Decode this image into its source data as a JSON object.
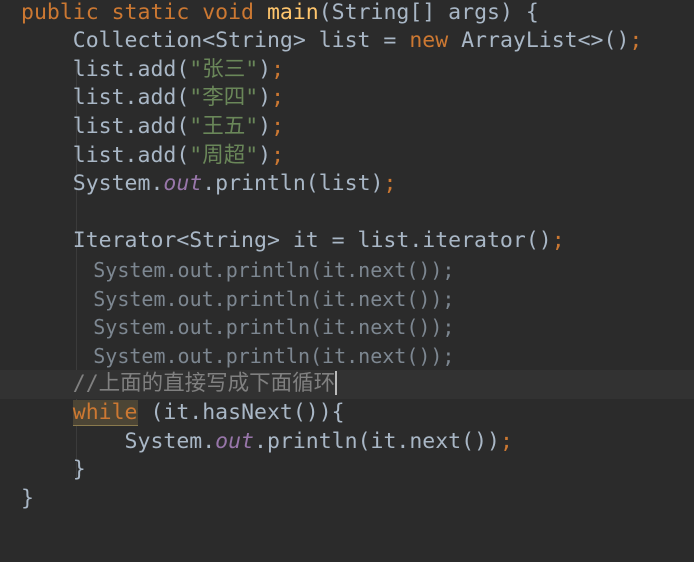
{
  "editor": {
    "lines": [
      {
        "segments": [
          {
            "t": "public static void ",
            "c": "kw"
          },
          {
            "t": "main",
            "c": "fn"
          },
          {
            "t": "(String[] args) {",
            "c": ""
          }
        ]
      },
      {
        "segments": [
          {
            "t": "    Collection<String> list = ",
            "c": ""
          },
          {
            "t": "new ",
            "c": "kw"
          },
          {
            "t": "ArrayList<>()",
            "c": ""
          },
          {
            "t": ";",
            "c": "kw"
          }
        ]
      },
      {
        "segments": [
          {
            "t": "    list.add(",
            "c": ""
          },
          {
            "t": "\"张三\"",
            "c": "str"
          },
          {
            "t": ")",
            "c": ""
          },
          {
            "t": ";",
            "c": "kw"
          }
        ]
      },
      {
        "segments": [
          {
            "t": "    list.add(",
            "c": ""
          },
          {
            "t": "\"李四\"",
            "c": "str"
          },
          {
            "t": ")",
            "c": ""
          },
          {
            "t": ";",
            "c": "kw"
          }
        ]
      },
      {
        "segments": [
          {
            "t": "    list.add(",
            "c": ""
          },
          {
            "t": "\"王五\"",
            "c": "str"
          },
          {
            "t": ")",
            "c": ""
          },
          {
            "t": ";",
            "c": "kw"
          }
        ]
      },
      {
        "segments": [
          {
            "t": "    list.add(",
            "c": ""
          },
          {
            "t": "\"周超\"",
            "c": "str"
          },
          {
            "t": ")",
            "c": ""
          },
          {
            "t": ";",
            "c": "kw"
          }
        ]
      },
      {
        "segments": [
          {
            "t": "    System.",
            "c": ""
          },
          {
            "t": "out",
            "c": "static-field"
          },
          {
            "t": ".println(list)",
            "c": ""
          },
          {
            "t": ";",
            "c": "kw"
          }
        ]
      },
      {
        "segments": []
      },
      {
        "segments": [
          {
            "t": "    Iterator<String> it = list.iterator()",
            "c": ""
          },
          {
            "t": ";",
            "c": "kw"
          }
        ]
      },
      {
        "style": "faded",
        "segments": [
          {
            "t": "      System.out.println(it.next());",
            "c": ""
          }
        ]
      },
      {
        "style": "faded",
        "segments": [
          {
            "t": "      System.out.println(it.next());",
            "c": ""
          }
        ]
      },
      {
        "style": "faded",
        "segments": [
          {
            "t": "      System.out.println(it.next());",
            "c": ""
          }
        ]
      },
      {
        "style": "faded",
        "segments": [
          {
            "t": "      System.out.println(it.next());",
            "c": ""
          }
        ]
      },
      {
        "style": "current",
        "caret": true,
        "segments": [
          {
            "t": "    //上面的直接写成下面循环",
            "c": "comment"
          }
        ]
      },
      {
        "segments": [
          {
            "t": "    ",
            "c": ""
          },
          {
            "t": "while",
            "c": "kw kw-hl"
          },
          {
            "t": " (it.hasNext()){",
            "c": ""
          }
        ]
      },
      {
        "segments": [
          {
            "t": "        System.",
            "c": ""
          },
          {
            "t": "out",
            "c": "static-field"
          },
          {
            "t": ".println(it.next())",
            "c": ""
          },
          {
            "t": ";",
            "c": "kw"
          }
        ]
      },
      {
        "segments": [
          {
            "t": "    }",
            "c": ""
          }
        ]
      },
      {
        "segments": [
          {
            "t": "}",
            "c": ""
          }
        ]
      }
    ]
  },
  "colors": {
    "background": "#2b2b2b",
    "current_line": "#323232",
    "default_text": "#a9b7c6",
    "keyword": "#cc7832",
    "method_name": "#ffc66d",
    "string": "#6a8759",
    "static_field": "#9876aa",
    "comment": "#808080",
    "faded_text": "#7d8791"
  }
}
